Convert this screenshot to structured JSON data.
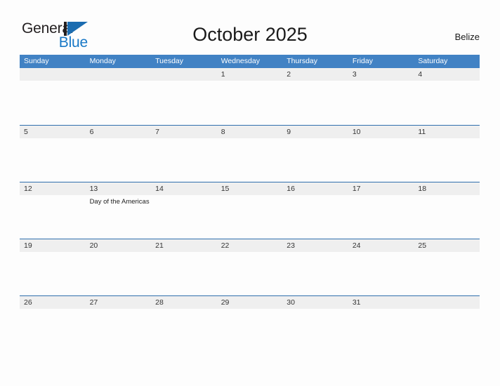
{
  "logo": {
    "text_top": "General",
    "text_bottom": "Blue",
    "mark_icon": "triangle-flag-icon",
    "color_dark": "#231f20",
    "color_blue": "#1878c6"
  },
  "header": {
    "title": "October 2025",
    "country": "Belize"
  },
  "calendar": {
    "header_color": "#4182c4",
    "band_color": "#efefef",
    "rule_color": "#2f6fad",
    "weekdays": [
      "Sunday",
      "Monday",
      "Tuesday",
      "Wednesday",
      "Thursday",
      "Friday",
      "Saturday"
    ],
    "weeks": [
      [
        {
          "day": "",
          "events": []
        },
        {
          "day": "",
          "events": []
        },
        {
          "day": "",
          "events": []
        },
        {
          "day": "1",
          "events": []
        },
        {
          "day": "2",
          "events": []
        },
        {
          "day": "3",
          "events": []
        },
        {
          "day": "4",
          "events": []
        }
      ],
      [
        {
          "day": "5",
          "events": []
        },
        {
          "day": "6",
          "events": []
        },
        {
          "day": "7",
          "events": []
        },
        {
          "day": "8",
          "events": []
        },
        {
          "day": "9",
          "events": []
        },
        {
          "day": "10",
          "events": []
        },
        {
          "day": "11",
          "events": []
        }
      ],
      [
        {
          "day": "12",
          "events": []
        },
        {
          "day": "13",
          "events": [
            "Day of the Americas"
          ]
        },
        {
          "day": "14",
          "events": []
        },
        {
          "day": "15",
          "events": []
        },
        {
          "day": "16",
          "events": []
        },
        {
          "day": "17",
          "events": []
        },
        {
          "day": "18",
          "events": []
        }
      ],
      [
        {
          "day": "19",
          "events": []
        },
        {
          "day": "20",
          "events": []
        },
        {
          "day": "21",
          "events": []
        },
        {
          "day": "22",
          "events": []
        },
        {
          "day": "23",
          "events": []
        },
        {
          "day": "24",
          "events": []
        },
        {
          "day": "25",
          "events": []
        }
      ],
      [
        {
          "day": "26",
          "events": []
        },
        {
          "day": "27",
          "events": []
        },
        {
          "day": "28",
          "events": []
        },
        {
          "day": "29",
          "events": []
        },
        {
          "day": "30",
          "events": []
        },
        {
          "day": "31",
          "events": []
        },
        {
          "day": "",
          "events": []
        }
      ]
    ]
  }
}
